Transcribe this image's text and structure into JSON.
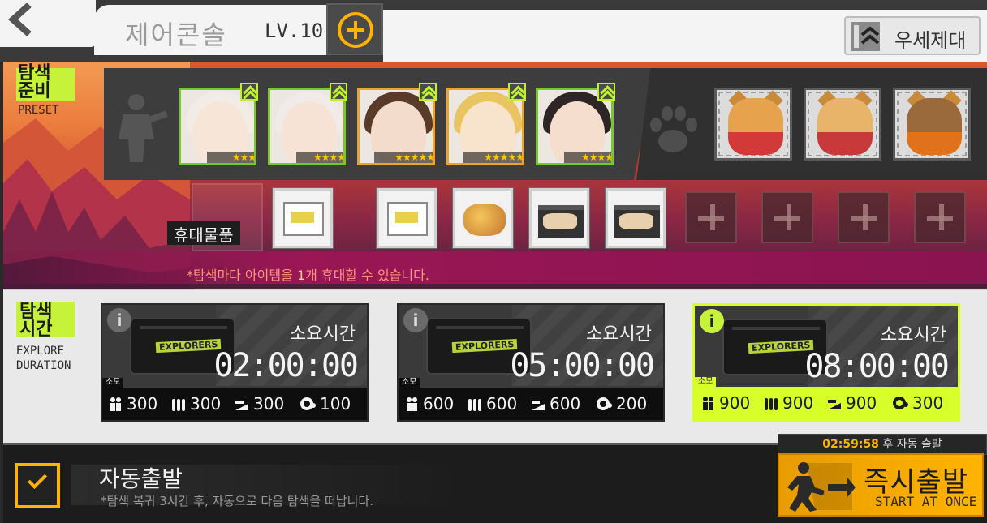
{
  "header": {
    "title": "제어콘솔",
    "level": "LV.10",
    "echelon_label": "우세제대"
  },
  "preset": {
    "tag": "탐색\n준비",
    "tag_en": "PRESET",
    "dolls": [
      {
        "stars": "★★★",
        "frame": "green",
        "hair": "#f1ece6",
        "skin": "#f7e6d8"
      },
      {
        "stars": "★★★★",
        "frame": "green",
        "hair": "#f0eae8",
        "skin": "#f7e2d6"
      },
      {
        "stars": "★★★★★",
        "frame": "gold",
        "hair": "#5a3a28",
        "skin": "#f3dccb"
      },
      {
        "stars": "★★★★★",
        "frame": "gold",
        "hair": "#e8c560",
        "skin": "#f8e4cc"
      },
      {
        "stars": "★★★★",
        "frame": "green",
        "hair": "#2e2626",
        "skin": "#f5dece"
      }
    ],
    "fairies": [
      {
        "body": "#e6a24c",
        "accent": "#d23a3a"
      },
      {
        "body": "#e8b46a",
        "accent": "#c83a3a"
      },
      {
        "body": "#9a6a3c",
        "accent": "#e0721c"
      }
    ],
    "carry_label": "휴대물품",
    "items": [
      "crate",
      "crate",
      "food",
      "box",
      "box"
    ],
    "notice_pre": "*탐색마다 아이템을 ",
    "notice_hl": "1",
    "notice_post": "개 휴대할 수 있습니다."
  },
  "explore": {
    "tag": "탐색\n시간",
    "tag_en": "EXPLORE\nDURATION",
    "cost_tag": "소모",
    "duration_label": "소요시간",
    "case_label": "EXPLORERS",
    "options": [
      {
        "time": "02:00:00",
        "manpower": "300",
        "ammo": "300",
        "rations": "300",
        "parts": "100",
        "selected": false
      },
      {
        "time": "05:00:00",
        "manpower": "600",
        "ammo": "600",
        "rations": "600",
        "parts": "200",
        "selected": false
      },
      {
        "time": "08:00:00",
        "manpower": "900",
        "ammo": "900",
        "rations": "900",
        "parts": "300",
        "selected": true
      }
    ]
  },
  "auto_depart": {
    "title": "자동출발",
    "desc": "*탐색 복귀 3시간 후, 자동으로 다음 탐색을 떠납니다.",
    "checked": true
  },
  "start": {
    "timer": "02:59:58",
    "timer_suffix": " 후 자동 출발",
    "label": "즉시출발",
    "label_en": "START AT ONCE"
  },
  "colors": {
    "accent_lime": "#d8ff2a",
    "accent_orange": "#ffb400",
    "doll_frame_green": "#78c82a",
    "doll_frame_gold": "#f0a22a"
  }
}
